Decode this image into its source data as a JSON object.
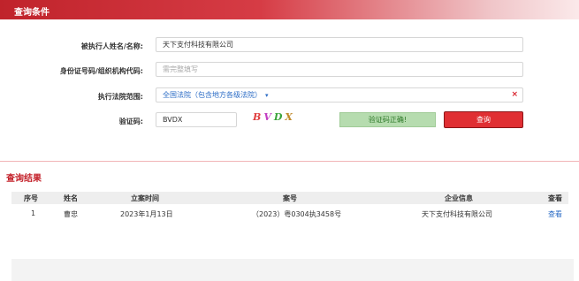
{
  "header": {
    "title": "查询条件"
  },
  "form": {
    "name_label": "被执行人姓名/名称:",
    "name_value": "天下支付科技有限公司",
    "id_label": "身份证号码/组织机构代码:",
    "id_placeholder": "需完整填写",
    "court_label": "执行法院范围:",
    "court_value": "全国法院（包含地方各级法院）",
    "court_caret": "▾",
    "clear_glyph": "×",
    "captcha_label": "验证码:",
    "captcha_value": "BVDX",
    "captcha_chars": [
      "B",
      "V",
      "D",
      "X"
    ],
    "captcha_ok": "验证码正确!",
    "query_button": "查询"
  },
  "results": {
    "title": "查询结果",
    "columns": [
      "序号",
      "姓名",
      "立案时间",
      "案号",
      "企业信息",
      "查看"
    ],
    "rows": [
      [
        "1",
        "曹忠",
        "2023年1月13日",
        "（2023）粤0304执3458号",
        "天下支付科技有限公司",
        "查看"
      ]
    ]
  },
  "colors": {
    "accent": "#d9232d",
    "link": "#2a6bc5",
    "success_bg": "#b6dcaf"
  }
}
